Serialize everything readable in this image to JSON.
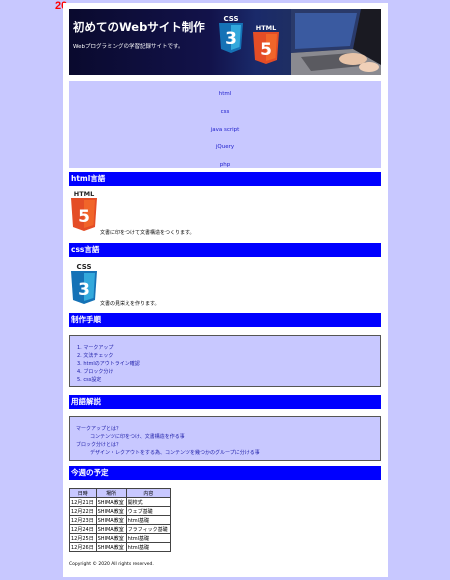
{
  "annotation": {
    "margin_label": "20px"
  },
  "header": {
    "title": "初めてのWebサイト制作",
    "subtitle": "Webプログラミングの学習記録サイトです。",
    "logo_css_text": "CSS",
    "logo_css_number": "3",
    "logo_html_text": "HTML",
    "logo_html_number": "5"
  },
  "nav": {
    "items": [
      "html",
      "css",
      "java script",
      "jQuery",
      "php"
    ]
  },
  "sections": {
    "html": {
      "title": "html言語",
      "logo_text": "HTML",
      "logo_number": "5",
      "description": "文書に印をつけて文書構造をつくります。"
    },
    "css": {
      "title": "css言語",
      "logo_text": "CSS",
      "logo_number": "3",
      "description": "文書の見栄えを作ります。"
    },
    "steps": {
      "title": "制作手順",
      "items": [
        "1. マークアップ",
        "2. 文法チェック",
        "3. htmlのアウトライン確認",
        "4. ブロック分け",
        "5. css設定"
      ]
    },
    "glossary": {
      "title": "用語解説",
      "entries": [
        {
          "term": "マークアップとは？",
          "definition": "コンテンツに印をつけ、文書構造を作る事"
        },
        {
          "term": "ブロック分けとは？",
          "definition": "デザイン・レクアウトをする為、コンテンツを幾つかのグループに分ける事"
        }
      ]
    },
    "schedule": {
      "title": "今週の予定",
      "columns": [
        "日時",
        "場所",
        "内容"
      ],
      "rows": [
        [
          "12月21日",
          "SHIMA教室",
          "開校式"
        ],
        [
          "12月22日",
          "SHIMA教室",
          "ウェブ基礎"
        ],
        [
          "12月23日",
          "SHIMA教室",
          "html基礎"
        ],
        [
          "12月24日",
          "SHIMA教室",
          "フラフィック基礎"
        ],
        [
          "12月25日",
          "SHIMA教室",
          "html基礎"
        ],
        [
          "12月26日",
          "SHIMA教室",
          "html基礎"
        ]
      ]
    }
  },
  "footer": {
    "copyright": "Copyright © 2020 All rights reserved."
  },
  "colors": {
    "page_bg": "#c8c8ff",
    "heading_bg": "#0000ff",
    "link": "#2020cc",
    "html5_orange": "#e44d26",
    "css3_blue": "#1572b6"
  }
}
